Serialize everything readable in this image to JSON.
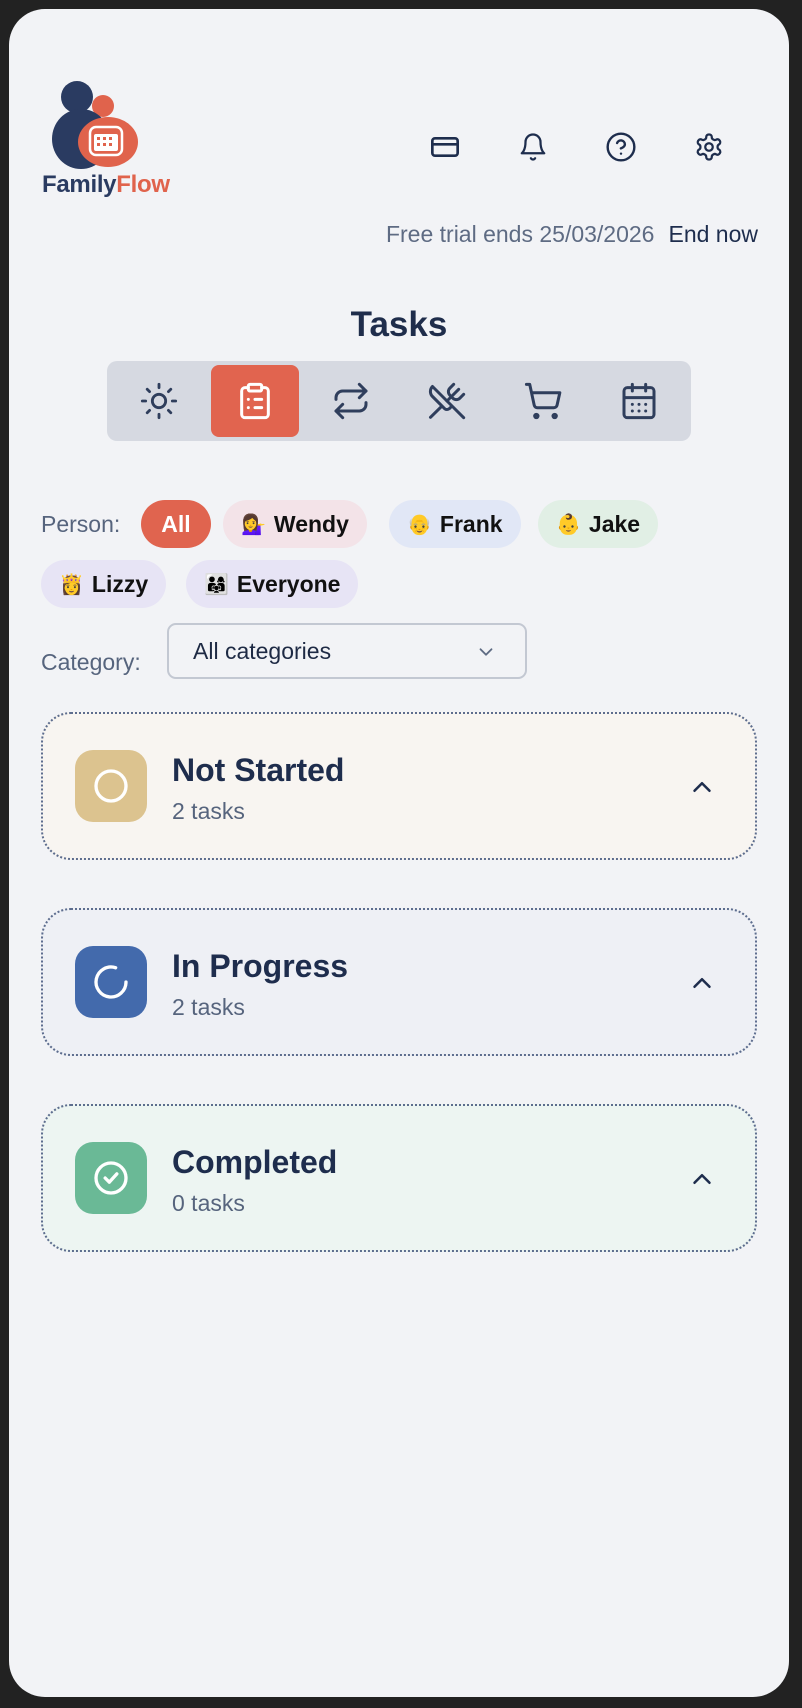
{
  "brand": {
    "name_part1": "Family",
    "name_part2": "Flow",
    "colors": {
      "navy": "#2a3b61",
      "coral": "#e0634c"
    }
  },
  "header": {
    "icons": [
      "credit-card-icon",
      "bell-icon",
      "help-circle-icon",
      "settings-gear-icon"
    ],
    "trial_text": "Free trial ends 25/03/2026",
    "end_now": "End now"
  },
  "page_title": "Tasks",
  "tabs": [
    {
      "icon": "sun-icon",
      "active": false
    },
    {
      "icon": "clipboard-icon",
      "active": true
    },
    {
      "icon": "repeat-icon",
      "active": false
    },
    {
      "icon": "utensils-crossed-icon",
      "active": false
    },
    {
      "icon": "shopping-cart-icon",
      "active": false
    },
    {
      "icon": "calendar-icon",
      "active": false
    }
  ],
  "person_filter": {
    "label": "Person:",
    "chips": [
      {
        "label": "All",
        "emoji": "",
        "selected": true,
        "color": "#e0644f"
      },
      {
        "label": "Wendy",
        "emoji": "💁‍♀️",
        "selected": false,
        "color": "#f3e3e8"
      },
      {
        "label": "Frank",
        "emoji": "👴",
        "selected": false,
        "color": "#e1e7f6"
      },
      {
        "label": "Jake",
        "emoji": "👶",
        "selected": false,
        "color": "#e1efe5"
      },
      {
        "label": "Lizzy",
        "emoji": "👸",
        "selected": false,
        "color": "#e7e4f5"
      },
      {
        "label": "Everyone",
        "emoji": "👨‍👩‍👧",
        "selected": false,
        "color": "#e7e4f5"
      }
    ]
  },
  "category_filter": {
    "label": "Category:",
    "value": "All categories"
  },
  "groups": [
    {
      "name": "Not Started",
      "count": "2 tasks",
      "icon": "circle-icon",
      "icon_color": "#dcc38f",
      "bg": "#f8f5f1"
    },
    {
      "name": "In Progress",
      "count": "2 tasks",
      "icon": "loader-icon",
      "icon_color": "#436aac",
      "bg": "#eef0f5"
    },
    {
      "name": "Completed",
      "count": "0 tasks",
      "icon": "check-circle-icon",
      "icon_color": "#6ab996",
      "bg": "#edf5f2"
    }
  ]
}
